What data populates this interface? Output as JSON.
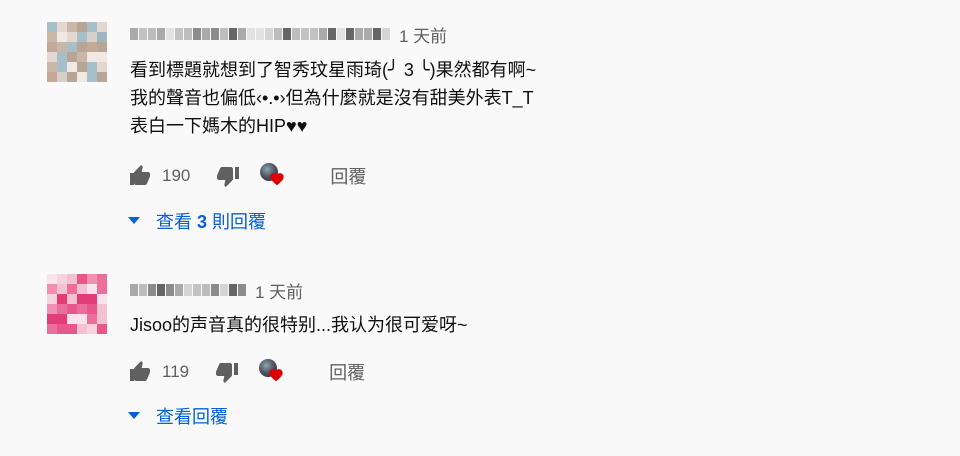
{
  "comments": [
    {
      "time": "1 天前",
      "text": "看到標題就想到了智秀玟星雨琦(╯ 3 ╰)果然都有啊~\n我的聲音也偏低‹•.•›但為什麼就是沒有甜美外表T_T\n表白一下媽木的HIP♥♥",
      "likes": "190",
      "reply_label": "回覆",
      "view_replies": {
        "prefix": "查看 ",
        "count": "3",
        "suffix": " 則回覆"
      },
      "avatar_icon": "pixelated-avatar-icon"
    },
    {
      "time": "1 天前",
      "text": "Jisoo的声音真的很特别...我认为很可爱呀~",
      "likes": "119",
      "reply_label": "回覆",
      "view_replies": {
        "prefix": "查看回覆",
        "count": "",
        "suffix": ""
      },
      "avatar_icon": "pixelated-avatar-icon"
    }
  ],
  "colors": {
    "link": "#065fd4",
    "meta": "#606060",
    "heart": "#e00000"
  }
}
